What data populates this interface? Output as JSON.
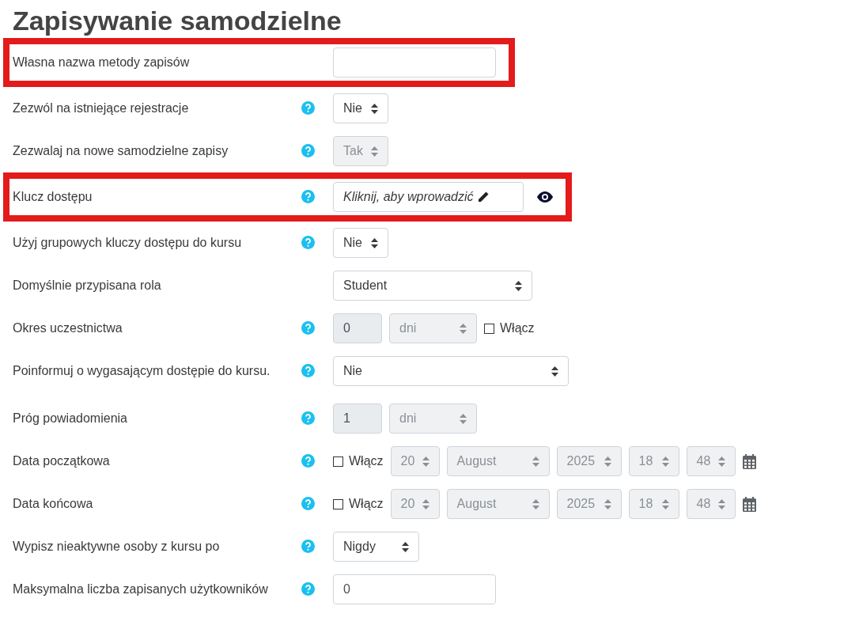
{
  "title": "Zapisywanie samodzielne",
  "rows": [
    {
      "label": "Własna nazwa metody zapisów",
      "help": false,
      "highlighted": true,
      "controls": [
        {
          "kind": "text",
          "disabled": false
        }
      ]
    },
    {
      "label": "Zezwól na istniejące rejestracje",
      "help": true,
      "highlighted": false,
      "controls": [
        {
          "kind": "select",
          "value": "Nie",
          "disabled": false
        }
      ]
    },
    {
      "label": "Zezwalaj na nowe samodzielne zapisy",
      "help": true,
      "highlighted": false,
      "controls": [
        {
          "kind": "select",
          "value": "Tak",
          "disabled": true
        }
      ]
    },
    {
      "label": "Klucz dostępu",
      "help": true,
      "highlighted": true,
      "controls": [
        {
          "kind": "inplace",
          "value": "Kliknij, aby wprowadzić"
        },
        {
          "kind": "reveal"
        }
      ]
    },
    {
      "label": "Użyj grupowych kluczy dostępu do kursu",
      "help": true,
      "highlighted": false,
      "controls": [
        {
          "kind": "select",
          "value": "Nie",
          "disabled": false
        }
      ]
    },
    {
      "label": "Domyślnie przypisana rola",
      "help": false,
      "highlighted": false,
      "controls": [
        {
          "kind": "select",
          "value": "Student",
          "disabled": false
        }
      ]
    },
    {
      "label": "Okres uczestnictwa",
      "help": true,
      "highlighted": false,
      "controls": [
        {
          "kind": "text",
          "value": "0",
          "disabled": true
        },
        {
          "kind": "select",
          "value": "dni",
          "disabled": true
        },
        {
          "kind": "checkbox",
          "label": "Włącz",
          "checked": false
        }
      ]
    },
    {
      "label": "Poinformuj o wygasającym dostępie do kursu.",
      "help": true,
      "highlighted": false,
      "controls": [
        {
          "kind": "select",
          "value": "Nie",
          "disabled": false
        }
      ]
    },
    {
      "label": "Próg powiadomienia",
      "help": true,
      "highlighted": false,
      "controls": [
        {
          "kind": "text",
          "value": "1",
          "disabled": true
        },
        {
          "kind": "select",
          "value": "dni",
          "disabled": true
        }
      ]
    },
    {
      "label": "Data początkowa",
      "help": true,
      "highlighted": false,
      "controls": [
        {
          "kind": "checkbox",
          "label": "Włącz",
          "checked": false
        },
        {
          "kind": "select",
          "value": "20",
          "disabled": true
        },
        {
          "kind": "select",
          "value": "August",
          "disabled": true
        },
        {
          "kind": "select",
          "value": "2025",
          "disabled": true
        },
        {
          "kind": "select",
          "value": "18",
          "disabled": true
        },
        {
          "kind": "select",
          "value": "48",
          "disabled": true
        },
        {
          "kind": "calendar"
        }
      ]
    },
    {
      "label": "Data końcowa",
      "help": true,
      "highlighted": false,
      "controls": [
        {
          "kind": "checkbox",
          "label": "Włącz",
          "checked": false
        },
        {
          "kind": "select",
          "value": "20",
          "disabled": true
        },
        {
          "kind": "select",
          "value": "August",
          "disabled": true
        },
        {
          "kind": "select",
          "value": "2025",
          "disabled": true
        },
        {
          "kind": "select",
          "value": "18",
          "disabled": true
        },
        {
          "kind": "select",
          "value": "48",
          "disabled": true
        },
        {
          "kind": "calendar"
        }
      ]
    },
    {
      "label": "Wypisz nieaktywne osoby z kursu po",
      "help": true,
      "highlighted": false,
      "controls": [
        {
          "kind": "select",
          "value": "Nigdy",
          "disabled": false
        }
      ]
    },
    {
      "label": "Maksymalna liczba zapisanych użytkowników",
      "help": true,
      "highlighted": false,
      "controls": [
        {
          "kind": "text",
          "value": "0",
          "disabled": false
        }
      ]
    }
  ]
}
